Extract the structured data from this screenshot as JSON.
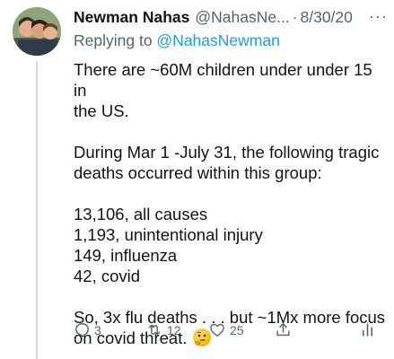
{
  "tweet": {
    "name": "Newman Nahas",
    "handle": "@NahasNe...",
    "separator": "·",
    "date": "8/30/20",
    "more": "···",
    "replying_prefix": "Replying to ",
    "replying_to": "@NahasNewman",
    "paragraphs": [
      [
        "There are ~60M children under under 15 in",
        "the US."
      ],
      [
        "During Mar 1 -July 31, the following tragic",
        "deaths occurred within this group:"
      ],
      [
        "13,106, all causes",
        "1,193, unintentional injury",
        "149, influenza",
        "42, covid"
      ],
      [
        "So, 3x flu deaths . . . but ~1Mx more focus",
        "on covid threat."
      ]
    ],
    "emoji": "thinking-face"
  },
  "actions": {
    "replies": "3",
    "retweets": "12",
    "likes": "25"
  },
  "icons": {
    "reply": "reply-icon",
    "retweet": "retweet-icon",
    "like": "heart-icon",
    "share": "share-icon",
    "analytics": "analytics-icon"
  },
  "colors": {
    "text": "#0f1419",
    "secondary": "#536471",
    "link": "#1d9bf0",
    "thread_line": "#cfd9de"
  }
}
